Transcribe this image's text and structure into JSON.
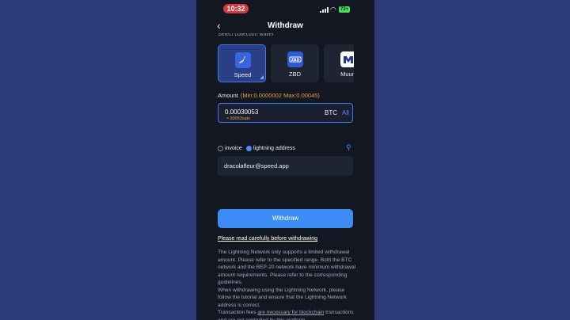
{
  "status_bar": {
    "time": "10:32",
    "battery": "73+"
  },
  "header": {
    "title": "Withdraw"
  },
  "section": {
    "label": "Select collection wallet"
  },
  "wallets": [
    {
      "name": "Speed",
      "selected": true,
      "color": "#ffffff"
    },
    {
      "name": "ZBD",
      "selected": false,
      "color": "#2d5bd8"
    },
    {
      "name": "Muun",
      "selected": false,
      "color": "#ffffff"
    }
  ],
  "amount": {
    "label": "Amount",
    "range": "(Min:0.0000002  Max:0.00045)",
    "value": "0.00030053",
    "sats": "≈ 30053sats",
    "currency": "BTC",
    "all_label": "All"
  },
  "mode": {
    "invoice_label": "invoice",
    "lightning_label": "lightning address"
  },
  "address": {
    "value": "dracolafleur@speed.app"
  },
  "withdraw_button": "Withdraw",
  "notice": "Please read carefully before withdrawing",
  "description": {
    "p1": "The Lightning Network only supports a limited withdrawal amount. Please refer to the specified range. Both the BTC network and the BEP-20 network have minimum withdrawal amount requirements. Please refer to the corresponding guidelines.",
    "p2": "When withdrawing using the Lightning Network, please follow the tutorial and ensure that the Lightning Network address is correct.",
    "p3a": "Transaction fees ",
    "p3b": "are necessary for blockchain",
    "p3c": " transactions and are not controlled by this platform."
  },
  "colors": {
    "accent": "#3d8cf5",
    "warning": "#e3a03a",
    "background": "#131722",
    "outer": "#2d3a78"
  }
}
